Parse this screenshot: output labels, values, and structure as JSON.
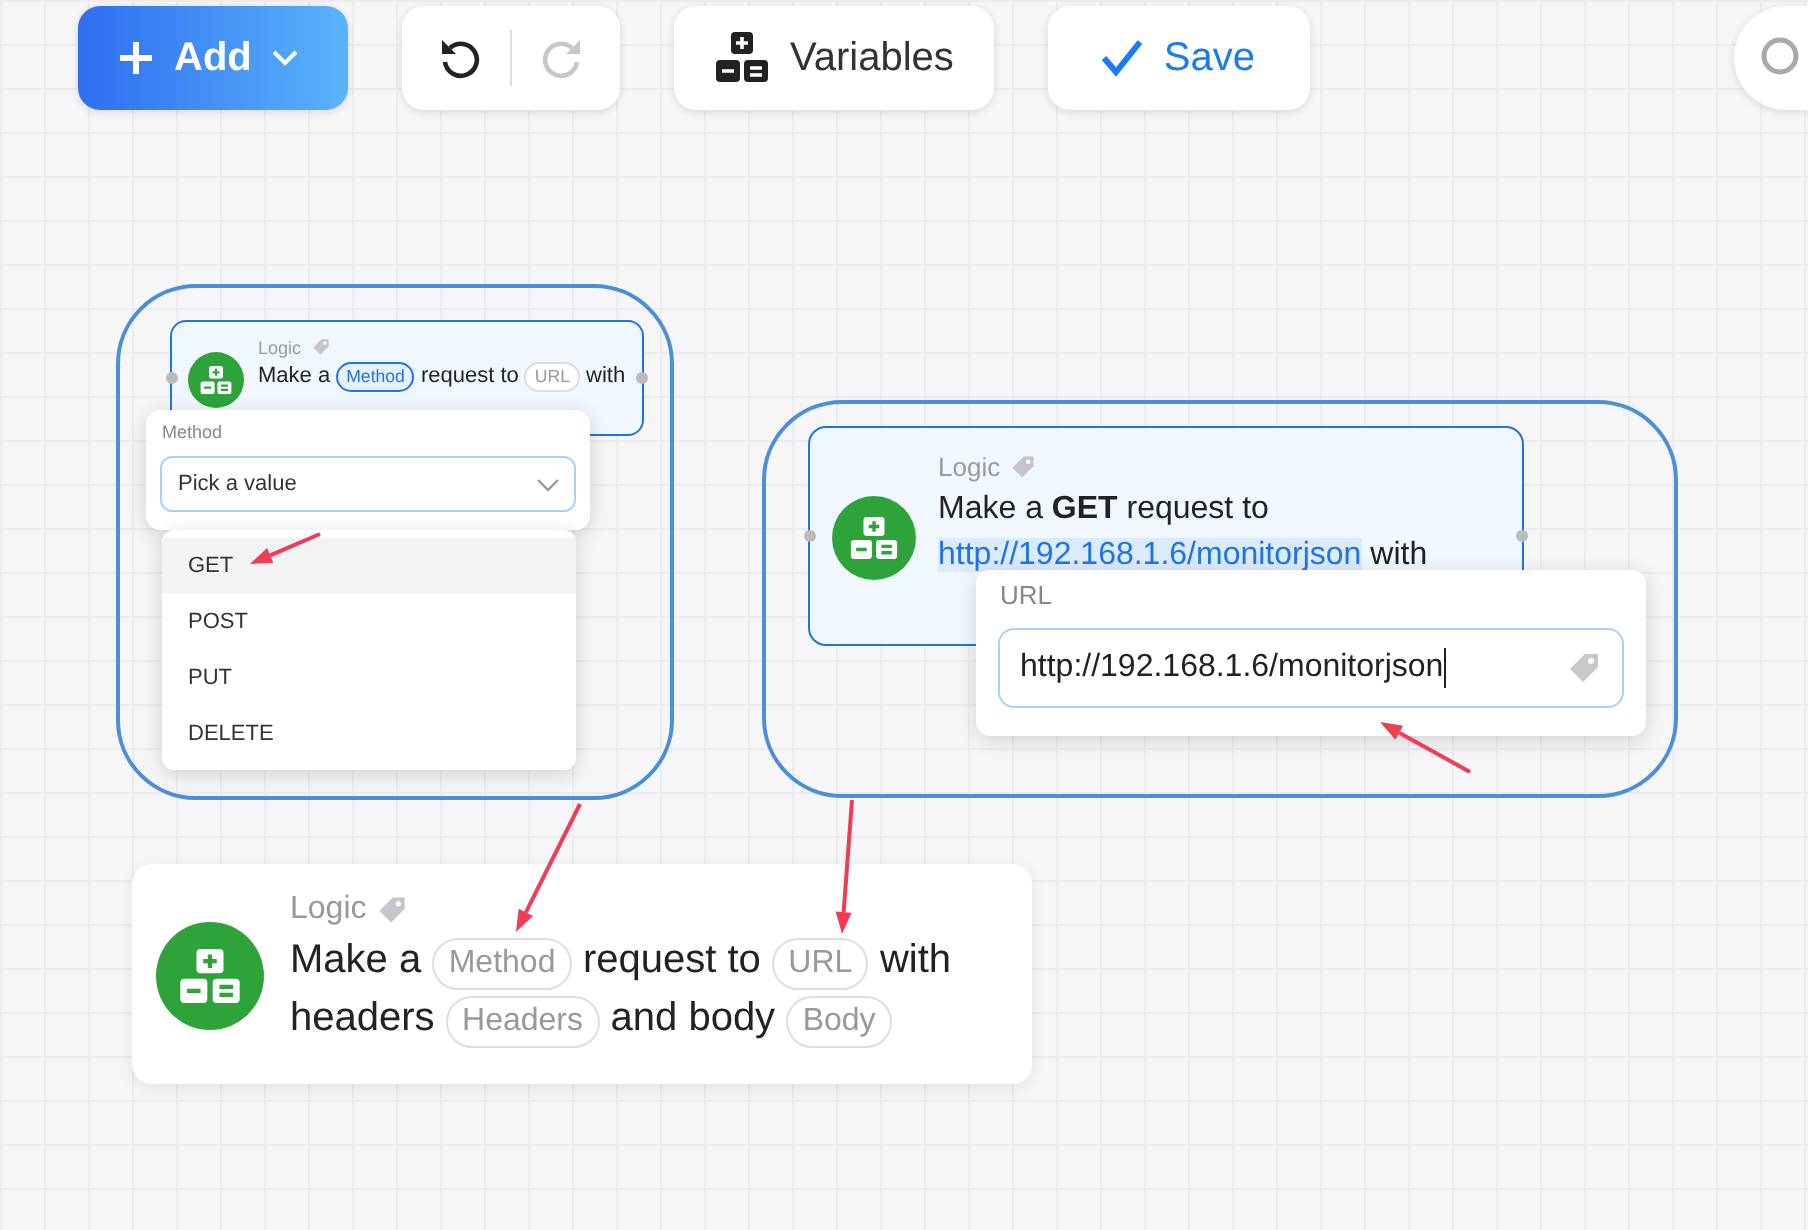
{
  "toolbar": {
    "add_button": {
      "label": "Add"
    },
    "undo_button": {
      "disabled": false
    },
    "redo_button": {
      "disabled": true
    },
    "variables_button": {
      "label": "Variables"
    },
    "save_button": {
      "label": "Save"
    }
  },
  "canvas": {
    "groups": [
      {
        "block": {
          "category": "Logic",
          "selected": true,
          "parts": [
            {
              "kind": "text",
              "text": "Make a"
            },
            {
              "kind": "chip",
              "text": "Method",
              "active": true
            },
            {
              "kind": "text",
              "text": "request to"
            },
            {
              "kind": "chip",
              "text": "URL",
              "active": false
            },
            {
              "kind": "text",
              "text": "with"
            }
          ]
        },
        "popup": {
          "kind": "select",
          "label": "Method",
          "placeholder": "Pick a value",
          "options": [
            {
              "label": "GET",
              "selected": true
            },
            {
              "label": "POST",
              "selected": false
            },
            {
              "label": "PUT",
              "selected": false
            },
            {
              "label": "DELETE",
              "selected": false
            }
          ]
        }
      },
      {
        "block": {
          "category": "Logic",
          "selected": true,
          "parts": [
            {
              "kind": "text",
              "text": "Make a **GET** request to"
            },
            {
              "kind": "link",
              "text": "http://192.168.1.6/monitorjson"
            },
            {
              "kind": "text",
              "text": "with"
            }
          ]
        },
        "popup": {
          "kind": "text",
          "label": "URL",
          "value": "http://192.168.1.6/monitorjson"
        }
      }
    ],
    "result_block": {
      "category": "Logic",
      "selected": false,
      "parts": [
        {
          "kind": "text",
          "text": "Make a"
        },
        {
          "kind": "chip",
          "text": "Method",
          "active": false
        },
        {
          "kind": "text",
          "text": "request to"
        },
        {
          "kind": "chip",
          "text": "URL",
          "active": false
        },
        {
          "kind": "text",
          "text": "with"
        },
        {
          "kind": "text",
          "text": "headers"
        },
        {
          "kind": "chip",
          "text": "Headers",
          "active": false
        },
        {
          "kind": "text",
          "text": "and body"
        },
        {
          "kind": "chip",
          "text": "Body",
          "active": false
        }
      ]
    }
  }
}
